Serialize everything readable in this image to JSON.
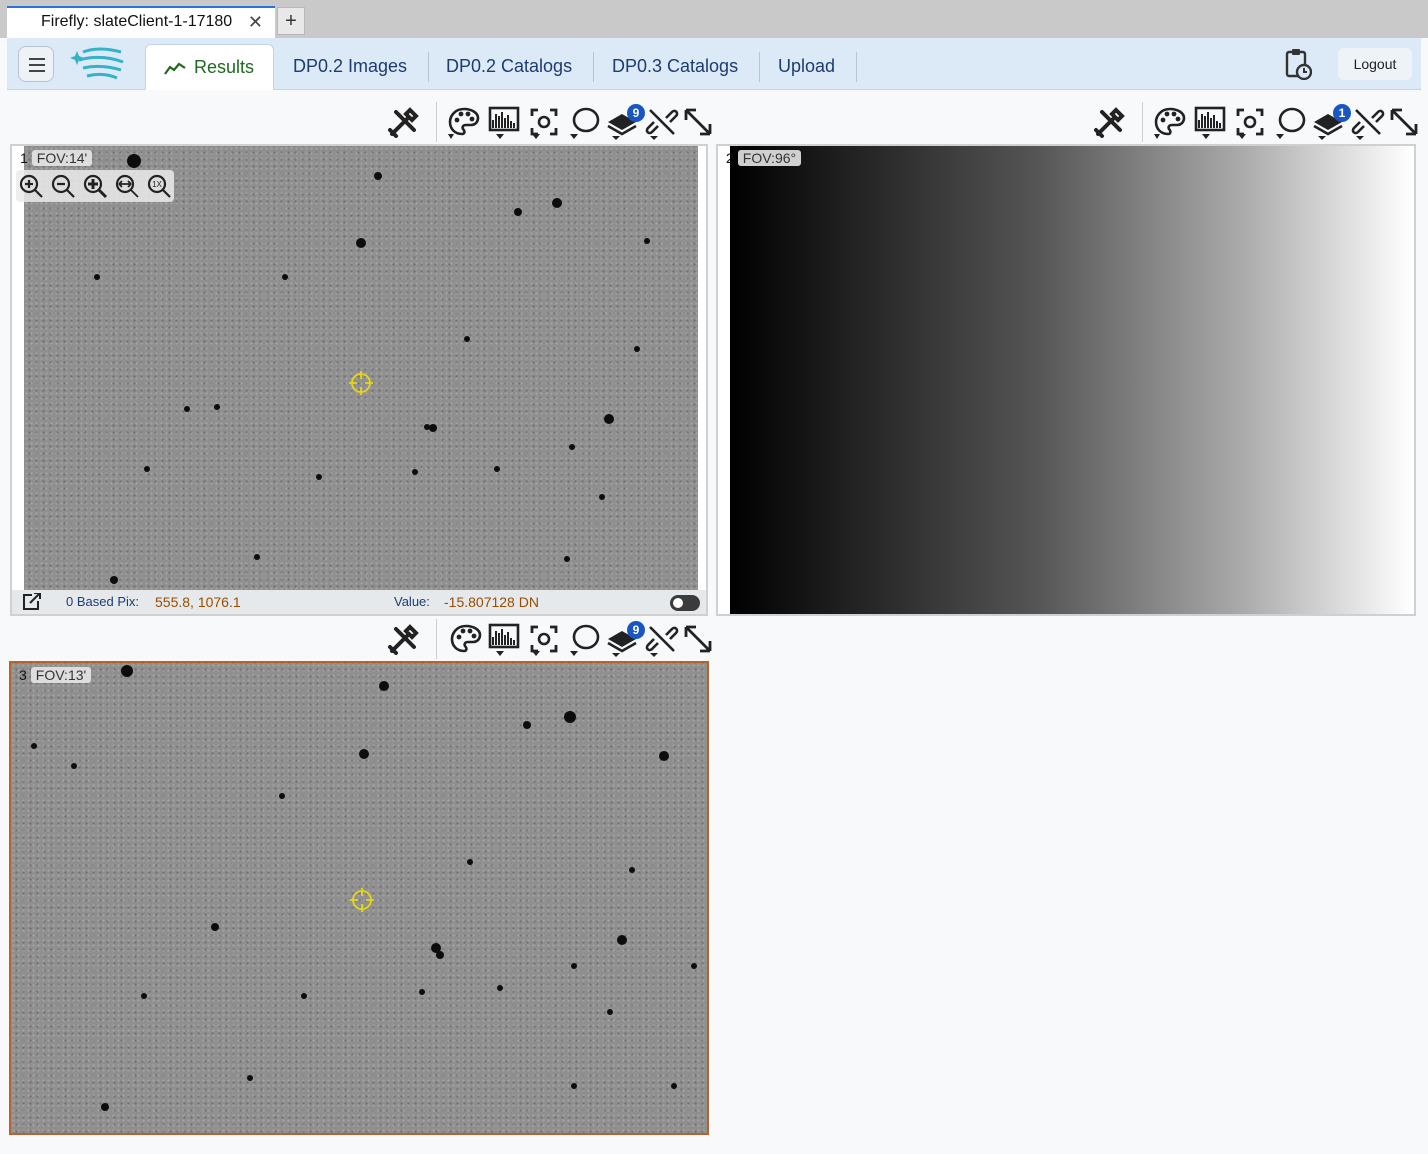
{
  "browser": {
    "tab_title": "Firefly: slateClient-1-17180",
    "close_glyph": "✕",
    "new_tab_glyph": "+"
  },
  "header": {
    "tabs": [
      {
        "label": "Results",
        "active": true,
        "icon": "chart-line-icon"
      },
      {
        "label": "DP0.2 Images"
      },
      {
        "label": "DP0.2 Catalogs"
      },
      {
        "label": "DP0.3 Catalogs"
      },
      {
        "label": "Upload"
      }
    ],
    "logout_label": "Logout",
    "icons": [
      "menu-icon",
      "firefly-logo",
      "clipboard-clock-icon"
    ]
  },
  "toolbar_icons": [
    "tools-icon",
    "palette-icon",
    "histogram-icon",
    "center-target-icon",
    "lasso-icon",
    "layers-icon",
    "unlink-icon",
    "expand-icon"
  ],
  "viewers": [
    {
      "number": "1",
      "fov": "FOV:14'",
      "layers_count": "9",
      "zoom_icons": [
        "zoom-in-icon",
        "zoom-out-icon",
        "zoom-fit-icon",
        "zoom-fill-icon",
        "zoom-1x-icon"
      ],
      "zoom_1x_text": "1X",
      "readout": {
        "pix_label": "0 Based Pix:",
        "pix_value": "555.8, 1076.1",
        "value_label": "Value:",
        "value": "-15.807128 DN"
      }
    },
    {
      "number": "2",
      "fov": "FOV:96°",
      "layers_count": "1"
    },
    {
      "number": "3",
      "fov": "FOV:13'",
      "layers_count": "9",
      "active": true
    }
  ],
  "colors": {
    "accent_blue": "#1a56c2",
    "active_border": "#b8632d",
    "active_tab_text": "#1f6a1f",
    "readout_value": "#9a4d00",
    "crosshair": "#e7d51a"
  }
}
